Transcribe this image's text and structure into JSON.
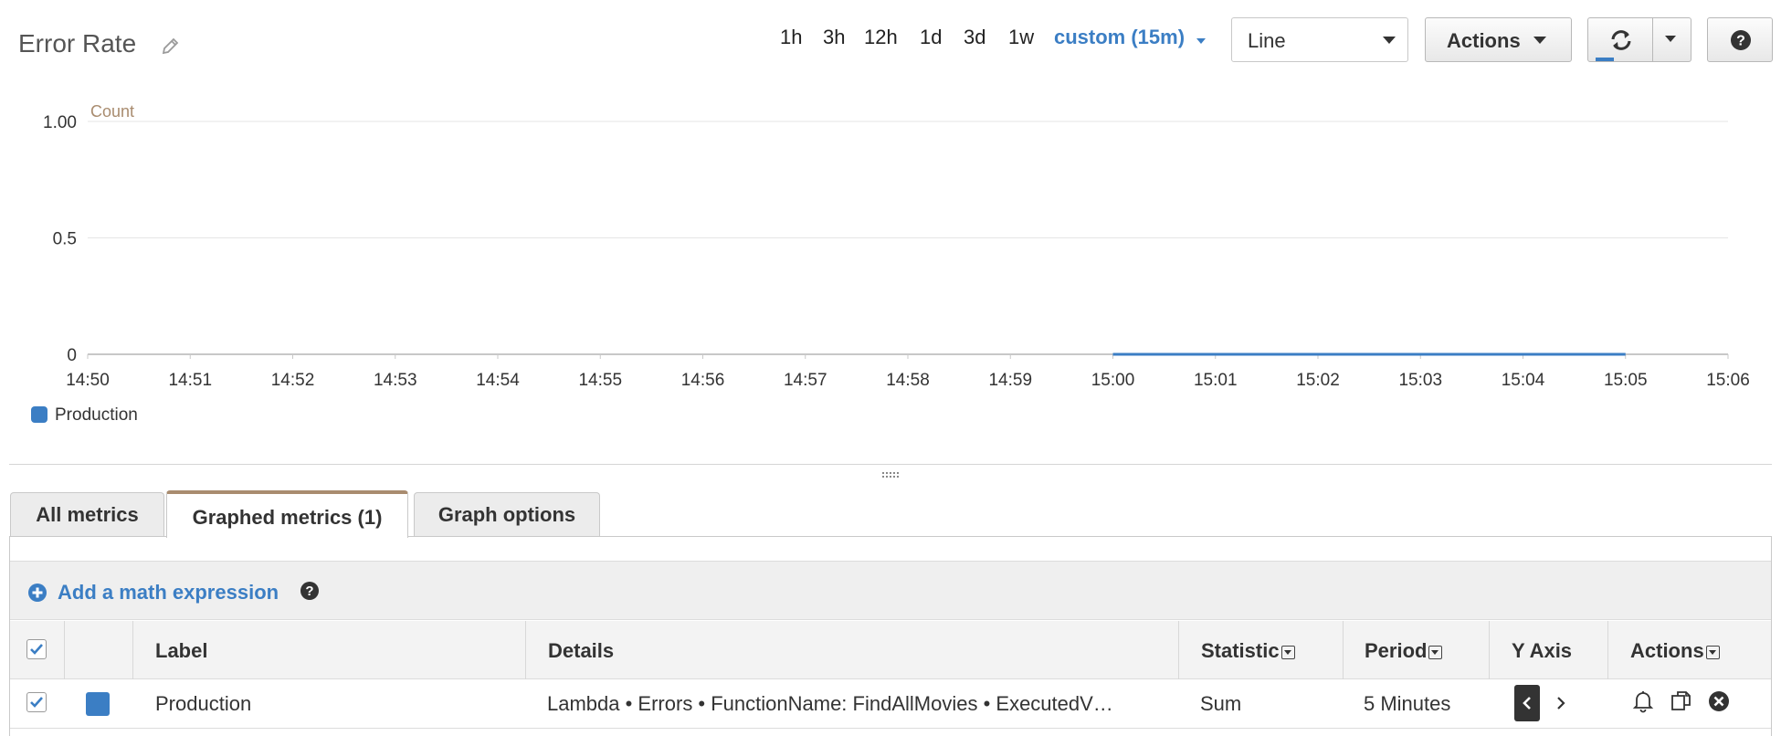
{
  "header": {
    "title": "Error Rate",
    "time_ranges": [
      "1h",
      "3h",
      "12h",
      "1d",
      "3d",
      "1w"
    ],
    "custom_range_label": "custom (15m)",
    "chart_type_value": "Line",
    "actions_label": "Actions"
  },
  "colors": {
    "accent": "#3b7ec4",
    "series_production": "#3b7ec4",
    "axis_unit": "#a98c6f"
  },
  "chart_data": {
    "type": "line",
    "ylabel": "Count",
    "ylim": [
      0,
      1.0
    ],
    "y_ticks": [
      "1.00",
      "0.5",
      "0"
    ],
    "x_ticks": [
      "14:50",
      "14:51",
      "14:52",
      "14:53",
      "14:54",
      "14:55",
      "14:56",
      "14:57",
      "14:58",
      "14:59",
      "15:00",
      "15:01",
      "15:02",
      "15:03",
      "15:04",
      "15:05",
      "15:06"
    ],
    "grid": true,
    "legend": "bottom-left",
    "series": [
      {
        "name": "Production",
        "x": [
          "15:00",
          "15:05"
        ],
        "values": [
          0,
          0
        ]
      }
    ]
  },
  "legend": {
    "series_name": "Production"
  },
  "tabs": [
    "All metrics",
    "Graphed metrics (1)",
    "Graph options"
  ],
  "active_tab": "Graphed metrics (1)",
  "math_expression": {
    "label": "Add a math expression"
  },
  "table": {
    "headers": {
      "label": "Label",
      "details": "Details",
      "statistic": "Statistic",
      "period": "Period",
      "y_axis": "Y Axis",
      "actions": "Actions"
    },
    "rows": [
      {
        "label": "Production",
        "details": "Lambda • Errors • FunctionName: FindAllMovies • ExecutedV…",
        "statistic": "Sum",
        "period": "5 Minutes",
        "checked": true
      }
    ]
  },
  "icons": {
    "edit": "pencil-icon",
    "refresh": "refresh-icon",
    "help": "question-circle-icon",
    "add": "plus-circle-icon",
    "alarm": "bell-icon",
    "duplicate": "copy-icon",
    "remove": "close-circle-icon"
  }
}
